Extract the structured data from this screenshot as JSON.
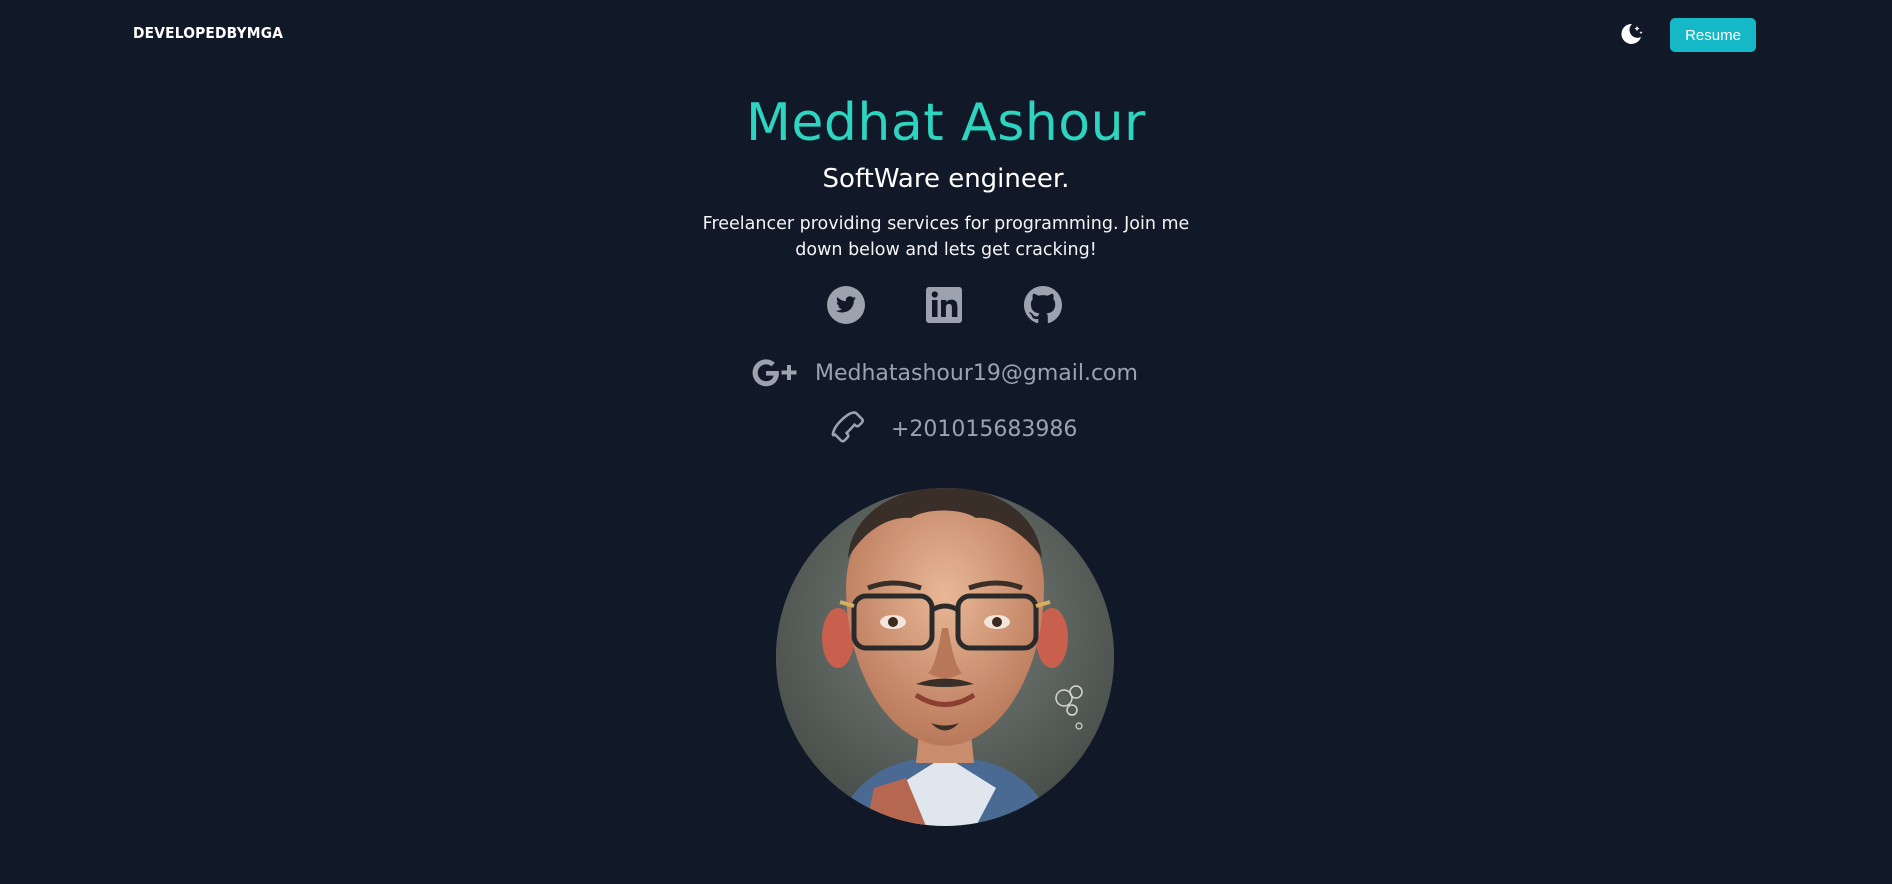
{
  "navbar": {
    "brand": "DEVELOPEDBYMGA",
    "theme_toggle_icon": "moon-stars-icon",
    "resume_label": "Resume",
    "accent_color": "#14b8c6"
  },
  "hero": {
    "name": "Medhat Ashour",
    "role": "SoftWare engineer.",
    "tagline": "Freelancer providing services for programming. Join me down below and lets get cracking!",
    "name_color": "#2dd4bf"
  },
  "social": [
    {
      "icon": "twitter-icon"
    },
    {
      "icon": "linkedin-icon"
    },
    {
      "icon": "github-icon"
    }
  ],
  "contact": {
    "email": "Medhatashour19@gmail.com",
    "email_icon": "google-plus-icon",
    "phone": "+201015683986",
    "phone_icon": "phone-icon"
  },
  "avatar": {
    "icon": "profile-avatar"
  },
  "colors": {
    "background": "#111827",
    "muted_text": "#9ca3af"
  }
}
